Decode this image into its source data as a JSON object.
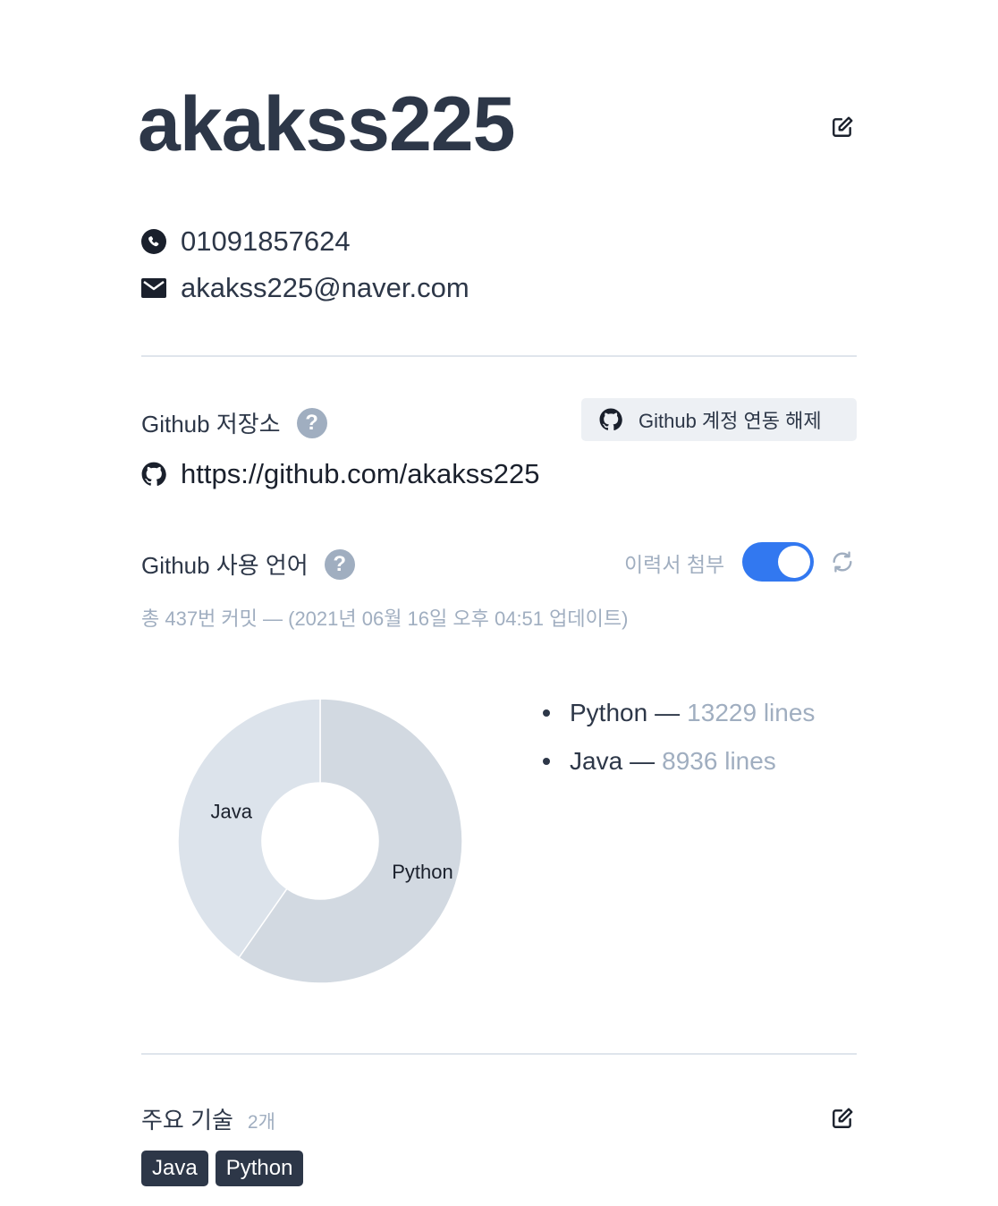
{
  "profile": {
    "username": "akakss225",
    "phone": "01091857624",
    "email": "akakss225@naver.com"
  },
  "github_repo": {
    "title": "Github 저장소",
    "help_symbol": "?",
    "unlink_button": "Github 계정 연동 해제",
    "url": "https://github.com/akakss225"
  },
  "github_languages": {
    "title": "Github 사용 언어",
    "help_symbol": "?",
    "attach_label": "이력서 첨부",
    "attach_enabled": true,
    "meta": "총 437번 커밋 — (2021년 06월 16일 오후 04:51 업데이트)",
    "legend": [
      {
        "lang": "Python",
        "sep": "—",
        "lines": "13229 lines"
      },
      {
        "lang": "Java",
        "sep": "—",
        "lines": "8936 lines"
      }
    ]
  },
  "chart_data": {
    "type": "pie",
    "categories": [
      "Python",
      "Java"
    ],
    "values": [
      13229,
      8936
    ],
    "colors": [
      "#d2d9e1",
      "#dce3eb"
    ],
    "donut": true
  },
  "skills": {
    "title": "주요 기술",
    "count": "2개",
    "tags": [
      "Java",
      "Python"
    ]
  },
  "icons": {
    "edit": "edit-icon",
    "phone": "phone-icon",
    "mail": "mail-icon",
    "github": "github-icon",
    "refresh": "refresh-icon"
  }
}
